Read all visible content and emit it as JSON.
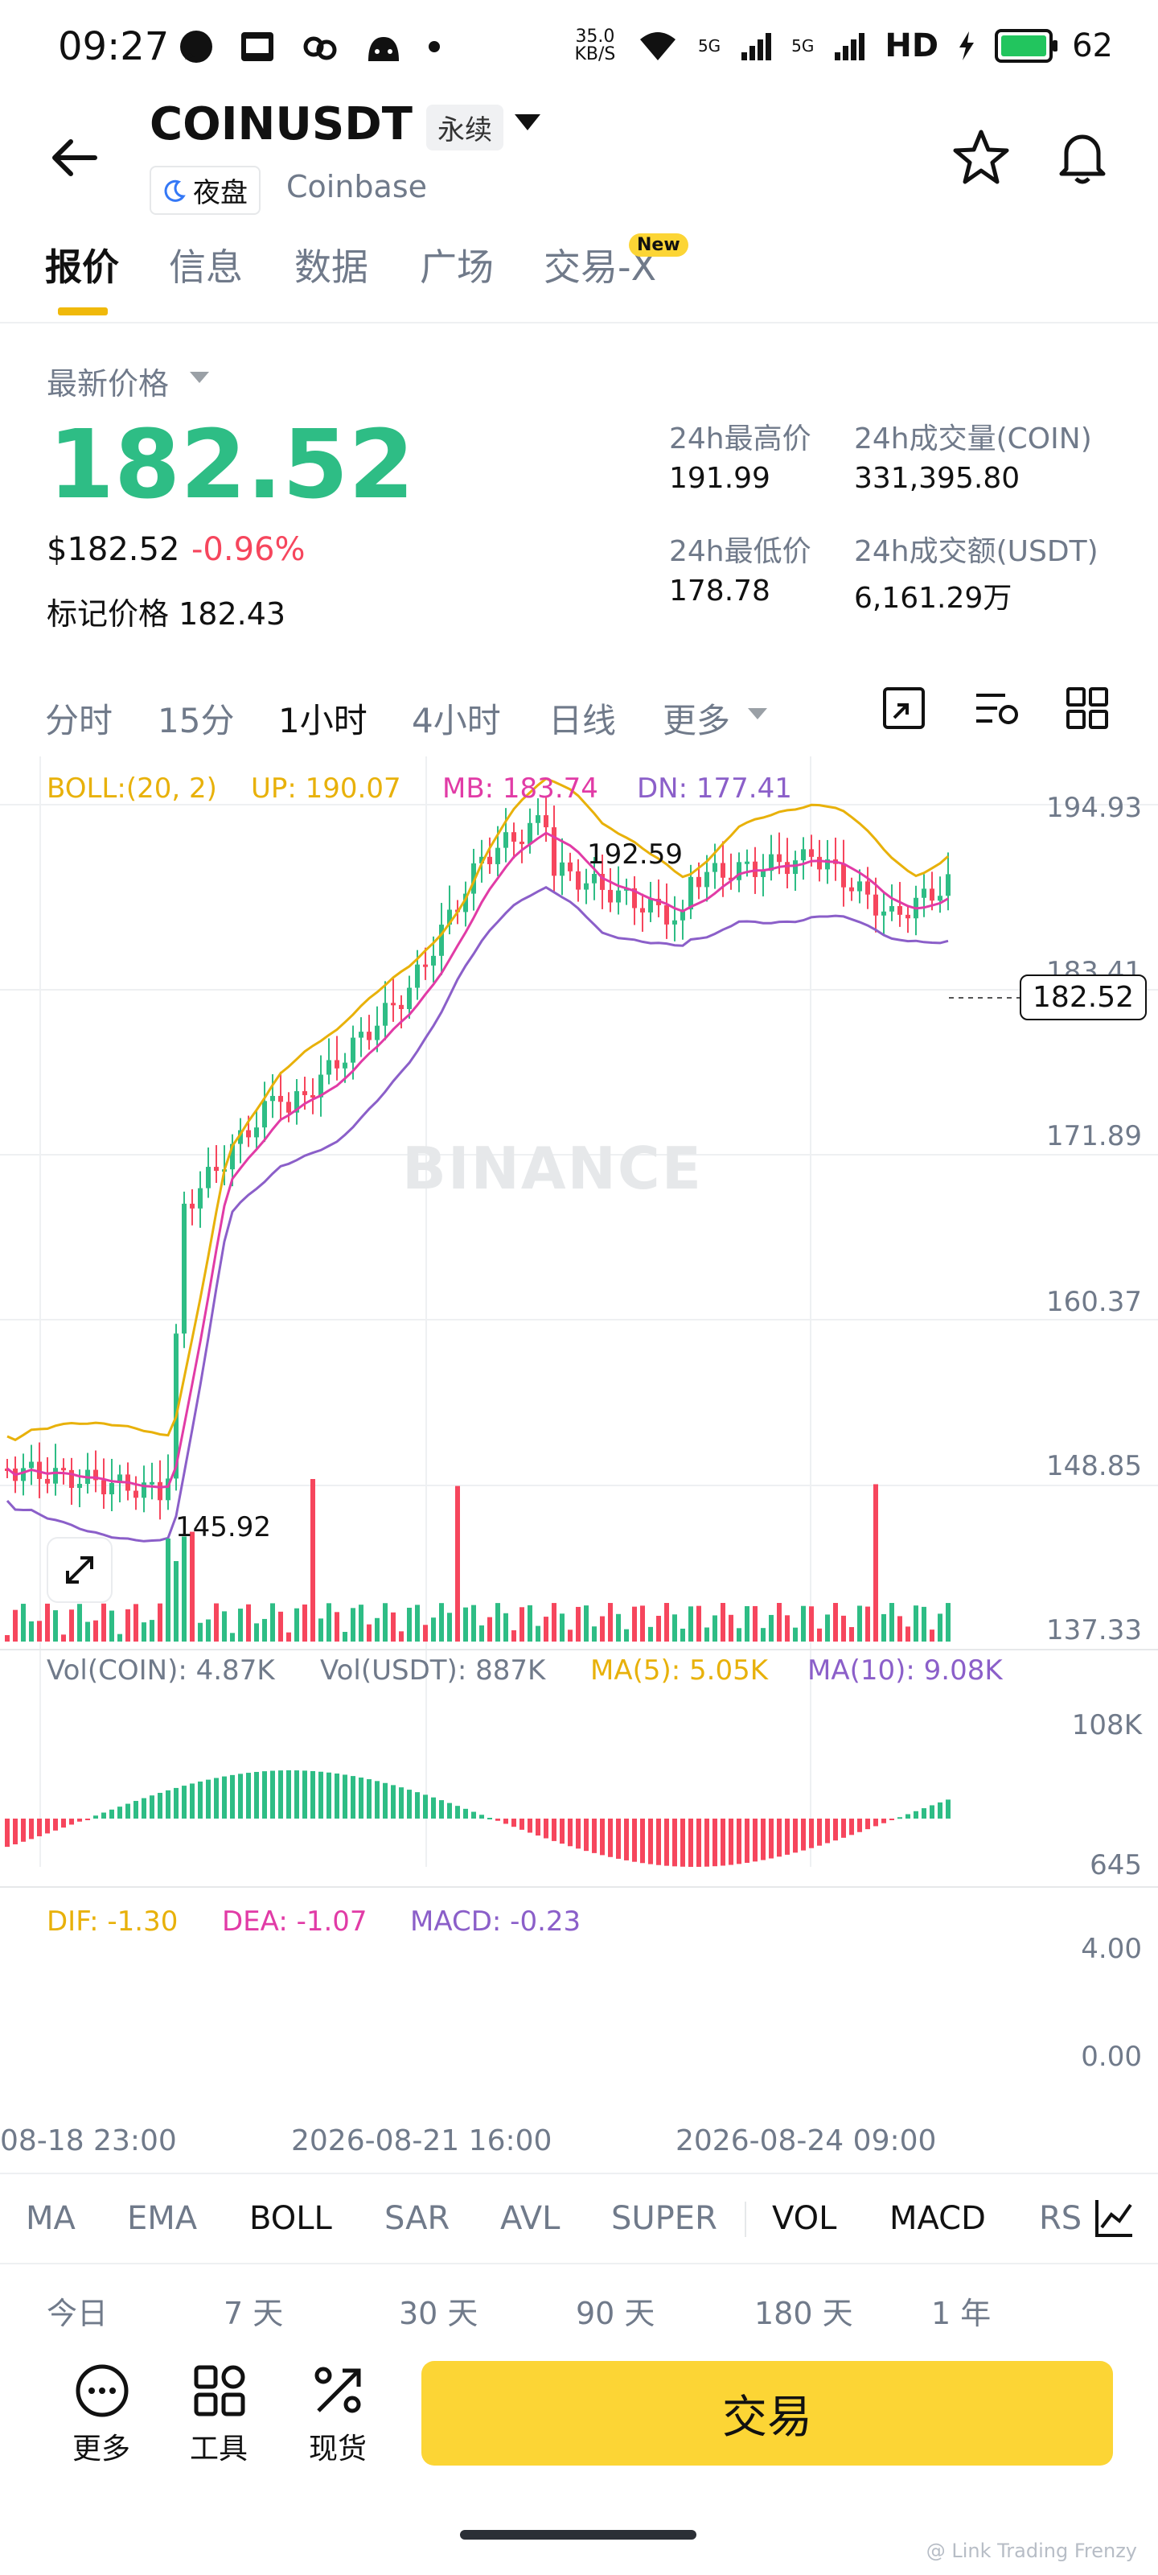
{
  "status": {
    "time": "09:27",
    "net_speed": "35.0 KB/S",
    "battery": "62",
    "net_types": [
      "5G",
      "5G",
      "HD"
    ]
  },
  "header": {
    "title": "COINUSDT",
    "tag": "永续",
    "night": "夜盘",
    "exchange": "Coinbase"
  },
  "tabs": [
    "报价",
    "信息",
    "数据",
    "广场",
    "交易-X"
  ],
  "tab_new": "New",
  "price": {
    "latest_label": "最新价格",
    "last": "182.52",
    "usd": "$182.52",
    "change": "-0.96%",
    "mark_label": "标记价格",
    "mark": "182.43"
  },
  "stats": [
    {
      "k": "24h最高价",
      "v": "191.99"
    },
    {
      "k": "24h成交量(COIN)",
      "v": "331,395.80"
    },
    {
      "k": "24h最低价",
      "v": "178.78"
    },
    {
      "k": "24h成交额(USDT)",
      "v": "6,161.29万"
    }
  ],
  "timeframes": [
    "分时",
    "15分",
    "1小时",
    "4小时",
    "日线",
    "更多"
  ],
  "boll": {
    "label": "BOLL:(20, 2)",
    "up": "UP: 190.07",
    "mb": "MB: 183.74",
    "dn": "DN: 177.41"
  },
  "price_axis": [
    "194.93",
    "183.41",
    "171.89",
    "160.37",
    "148.85",
    "137.33"
  ],
  "current_price_tag": "182.52",
  "annotations": {
    "high": "192.59",
    "low": "145.92"
  },
  "watermark": "BINANCE",
  "vol": {
    "coin": "Vol(COIN): 4.87K",
    "usdt": "Vol(USDT): 887K",
    "ma5": "MA(5): 5.05K",
    "ma10": "MA(10): 9.08K",
    "axis_top": "108K",
    "axis_bottom": "645"
  },
  "macd": {
    "dif": "DIF: -1.30",
    "dea": "DEA: -1.07",
    "macd": "MACD: -0.23",
    "axis_top": "4.00",
    "axis_mid": "0.00"
  },
  "dates": [
    "08-18 23:00",
    "2026-08-21 16:00",
    "2026-08-24 09:00"
  ],
  "indicators": [
    "MA",
    "EMA",
    "BOLL",
    "SAR",
    "AVL",
    "SUPER",
    "VOL",
    "MACD",
    "RS"
  ],
  "ranges": [
    "今日",
    "7 天",
    "30 天",
    "90 天",
    "180 天",
    "1 年"
  ],
  "bottom": {
    "more": "更多",
    "tools": "工具",
    "spot": "现货",
    "trade": "交易"
  },
  "footer": "@ Link Trading Frenzy",
  "colors": {
    "up": "#2ebd85",
    "down": "#f6465d",
    "accent": "#fcd535",
    "boll_up": "#e8b10a",
    "boll_mb": "#e13ba6",
    "boll_dn": "#8b5fc9"
  }
}
